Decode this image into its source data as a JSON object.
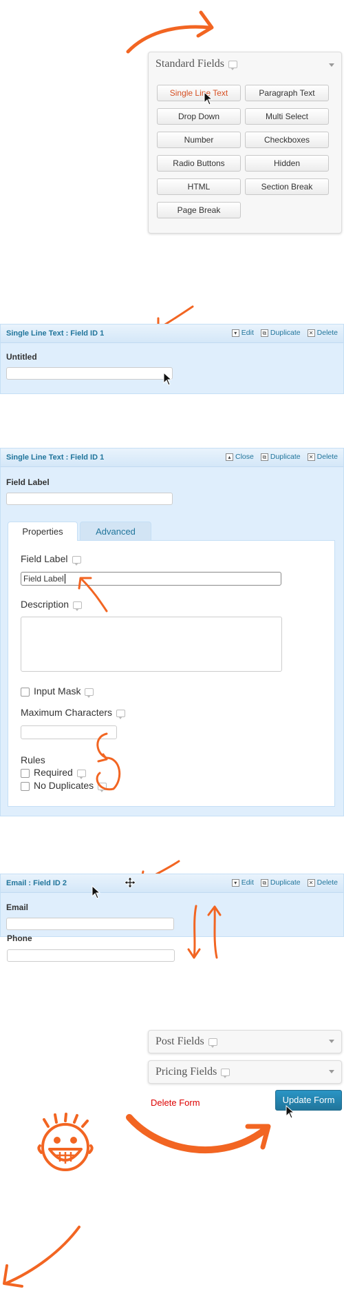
{
  "standard_fields": {
    "title": "Standard Fields",
    "buttons": [
      "Single Line Text",
      "Paragraph Text",
      "Drop Down",
      "Multi Select",
      "Number",
      "Checkboxes",
      "Radio Buttons",
      "Hidden",
      "HTML",
      "Section Break",
      "Page Break"
    ]
  },
  "field1": {
    "header": "Single Line Text : Field ID 1",
    "edit": "Edit",
    "duplicate": "Duplicate",
    "delete": "Delete",
    "label": "Untitled"
  },
  "field1_edit": {
    "header": "Single Line Text : Field ID 1",
    "close": "Close",
    "duplicate": "Duplicate",
    "delete": "Delete",
    "label": "Field Label",
    "tabs": [
      "Properties",
      "Advanced"
    ],
    "field_label_title": "Field Label",
    "field_label_value": "Field Label",
    "description": "Description",
    "input_mask": "Input Mask",
    "max_chars": "Maximum Characters",
    "rules": "Rules",
    "required": "Required",
    "no_duplicates": "No Duplicates"
  },
  "field2": {
    "header": "Email : Field ID 2",
    "edit": "Edit",
    "duplicate": "Duplicate",
    "delete": "Delete",
    "email_label": "Email",
    "phone_label": "Phone"
  },
  "bottom": {
    "post_fields": "Post Fields",
    "pricing_fields": "Pricing Fields",
    "delete_form": "Delete Form",
    "update_form": "Update Form"
  },
  "colors": {
    "accent_orange": "#f26522",
    "link_blue": "#21759b",
    "field_bg": "#dfeefc",
    "delete_red": "#dd0000"
  }
}
